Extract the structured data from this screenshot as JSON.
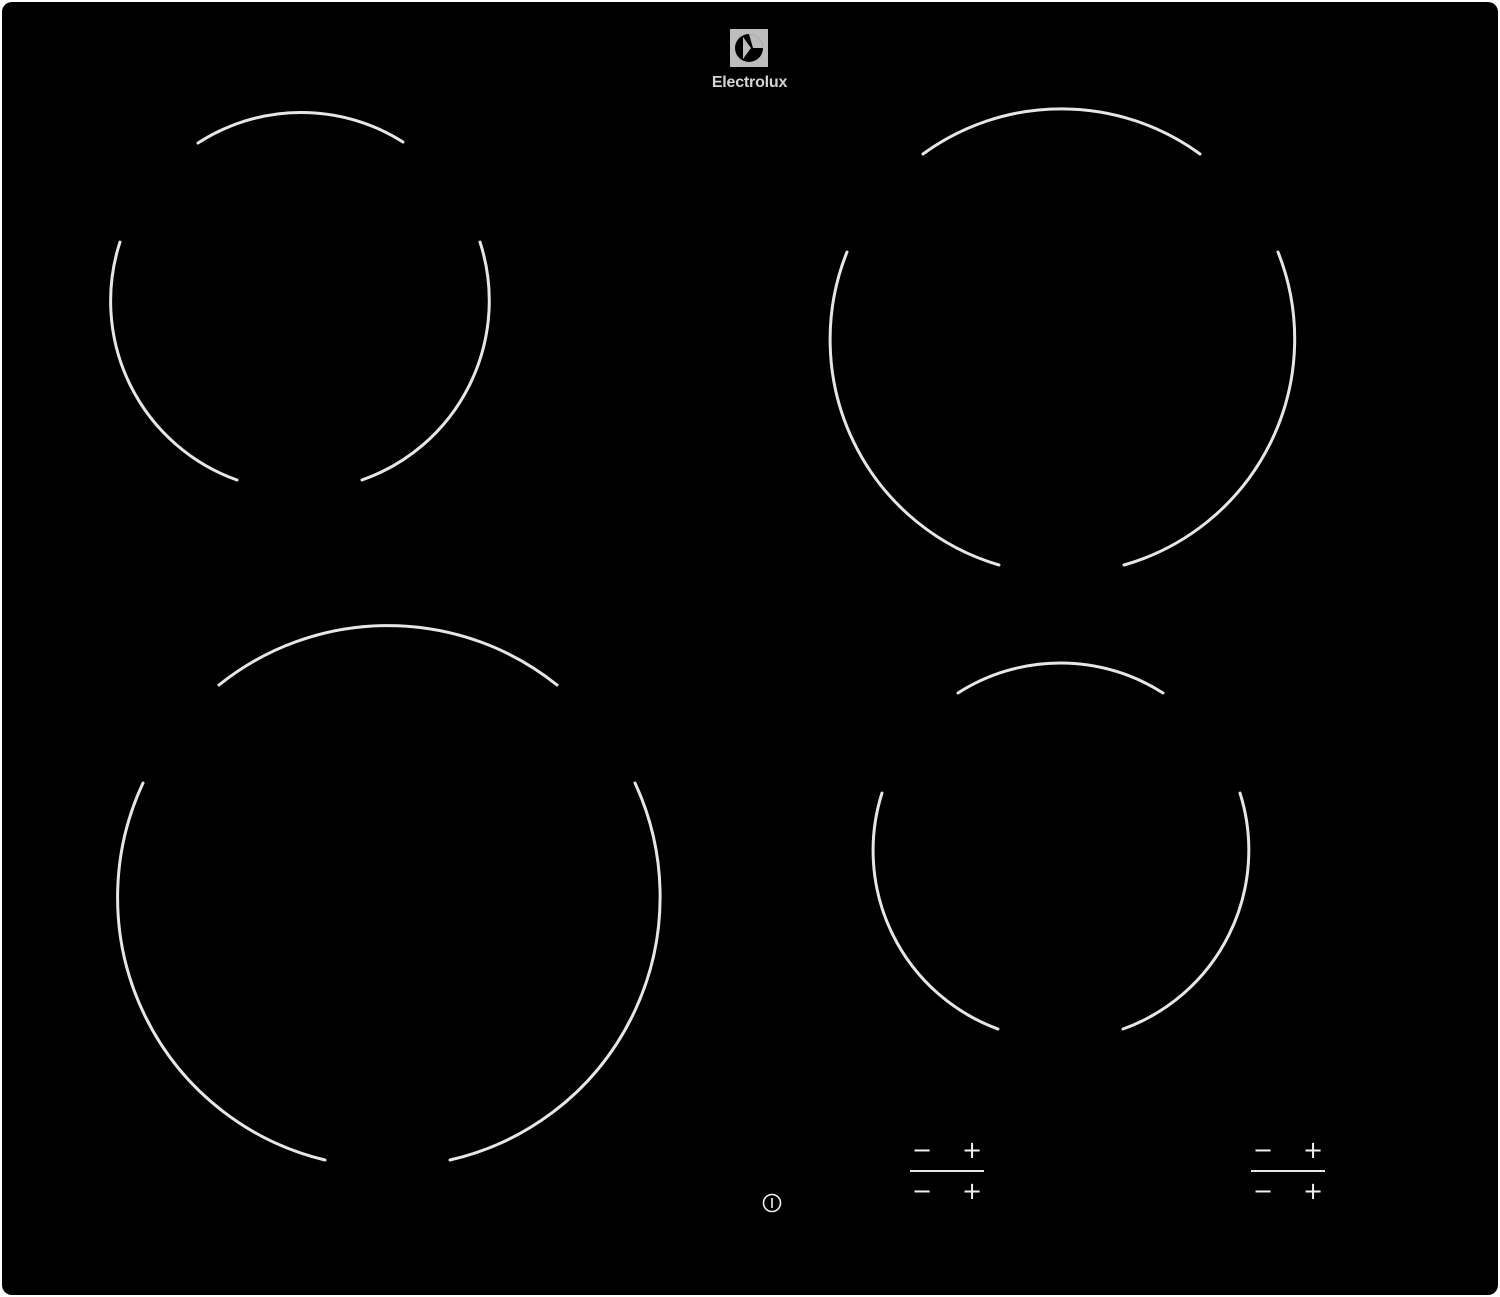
{
  "brand": {
    "name": "Electrolux",
    "logo_icon": "electrolux-logo-icon",
    "text_color": "#d4d4d4"
  },
  "cooktop": {
    "surface_color": "#000000",
    "marking_color": "#e6e6e6",
    "zones": [
      "front-left",
      "rear-left",
      "rear-right",
      "front-right"
    ]
  },
  "controls": {
    "power_icon": "power-icon",
    "left_pair": {
      "minus_top": "−",
      "plus_top": "+",
      "minus_bottom": "−",
      "plus_bottom": "+"
    },
    "right_pair": {
      "minus_top": "−",
      "plus_top": "+",
      "minus_bottom": "−",
      "plus_bottom": "+"
    }
  }
}
